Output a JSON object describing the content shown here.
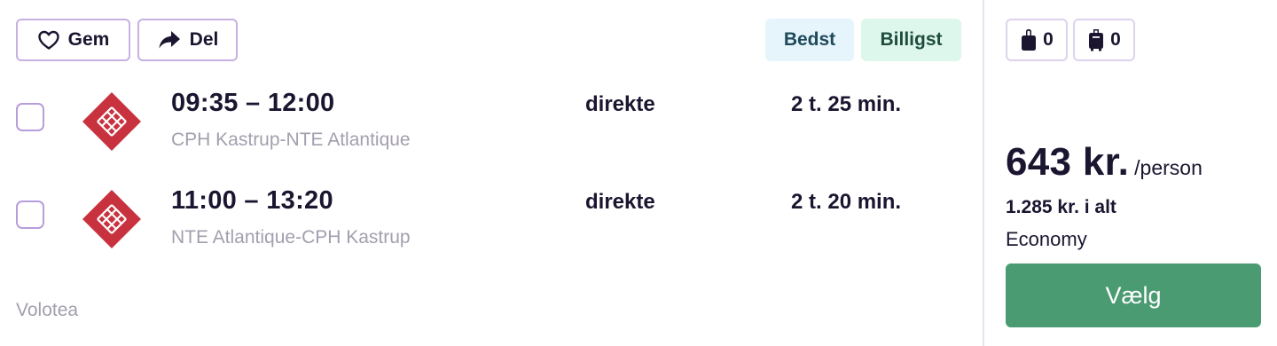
{
  "actions": {
    "save_label": "Gem",
    "share_label": "Del"
  },
  "badges": {
    "best": "Bedst",
    "cheapest": "Billigst"
  },
  "flights": [
    {
      "times": "09:35 – 12:00",
      "route": "CPH Kastrup-NTE Atlantique",
      "stops": "direkte",
      "duration": "2 t. 25 min."
    },
    {
      "times": "11:00 – 13:20",
      "route": "NTE Atlantique-CPH Kastrup",
      "stops": "direkte",
      "duration": "2 t. 20 min."
    }
  ],
  "airline": {
    "name": "Volotea",
    "logo_icon": "volotea-logo-icon"
  },
  "baggage": {
    "personal_item_count": "0",
    "cabin_bag_count": "0"
  },
  "pricing": {
    "amount": "643 kr.",
    "unit": "/person",
    "total": "1.285 kr. i alt",
    "cabin_class": "Economy",
    "select_label": "Vælg"
  },
  "colors": {
    "accent_border": "#c6b1e2",
    "badge_best_bg": "#e6f5fc",
    "badge_cheapest_bg": "#ddf7ec",
    "select_button": "#4a9a72",
    "logo_red": "#c8323f"
  }
}
